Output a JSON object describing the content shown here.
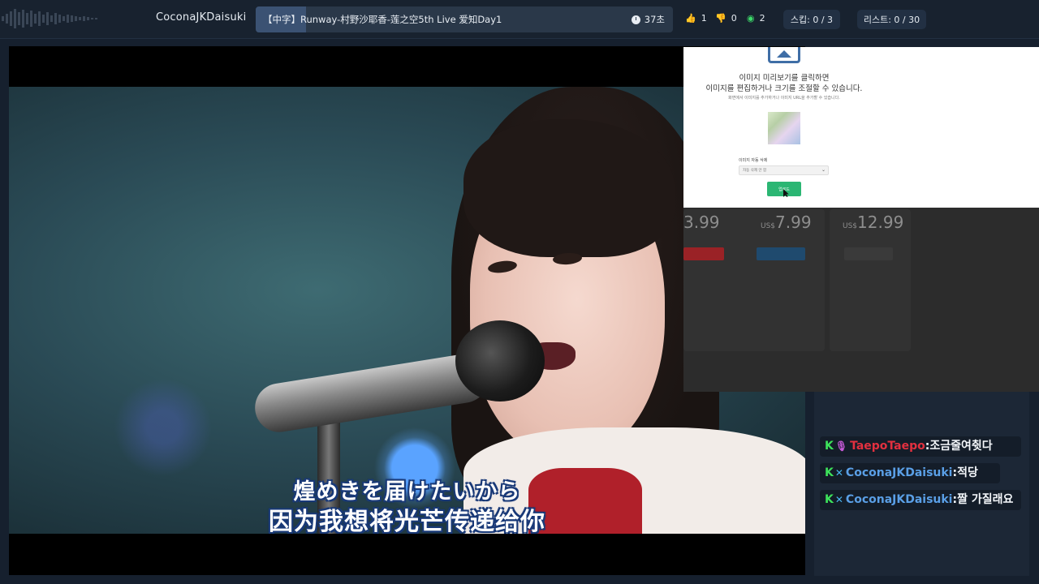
{
  "topbar": {
    "username": "CoconaJKDaisuki",
    "now_playing": {
      "title": "【中字】Runway-村野沙耶香-莲之空5th Live 爱知Day1",
      "progress": 0.12,
      "time_left": "37초"
    },
    "likes": "1",
    "dislikes": "0",
    "viewers": "2",
    "skip": "스킵: 0 / 3",
    "playlist": "리스트: 0 / 30",
    "icons": [
      "sound-wave-icon",
      "clock-icon",
      "thumbs-up-icon",
      "thumbs-down-icon",
      "eye-icon"
    ]
  },
  "video": {
    "subtitle_jp": "煌めきを届けたいから",
    "subtitle_cn": "因为我想将光芒传递给你"
  },
  "dialog": {
    "line1": "이미지 미리보기를 클릭하면",
    "line2": "이미지를 편집하거나 크기를 조절할 수 있습니다.",
    "small": "화면에서 이미지를 추가하거나 이미지 URL을 추가할 수 있습니다.",
    "label": "이미지 자동 삭제",
    "select_value": "자동 삭제 안 함",
    "button": "업로드"
  },
  "pricing": {
    "prices": [
      {
        "currency": "",
        "amount": "3.99",
        "button_color": "#c0282d"
      },
      {
        "currency": "US$",
        "amount": "7.99",
        "button_color": "#2b5e8c"
      },
      {
        "currency": "US$",
        "amount": "12.99",
        "button_color": "#3a3a3a"
      }
    ]
  },
  "chat": {
    "messages": [
      {
        "badge": "K",
        "nick": "TaepoTaepo",
        "text": ":조금줄여췻다",
        "nick_color": "#e3303f"
      },
      {
        "badge": "K",
        "nick": "CoconaJKDaisuki",
        "text": ":적당",
        "nick_color": "#5a9fe6"
      },
      {
        "badge": "K",
        "nick": "CoconaJKDaisuki",
        "text": ":짤 가질래요",
        "nick_color": "#5a9fe6"
      }
    ]
  },
  "colors": {
    "background": "#16202e",
    "accent_green": "#2bb673",
    "badge_green": "#3de35b"
  }
}
